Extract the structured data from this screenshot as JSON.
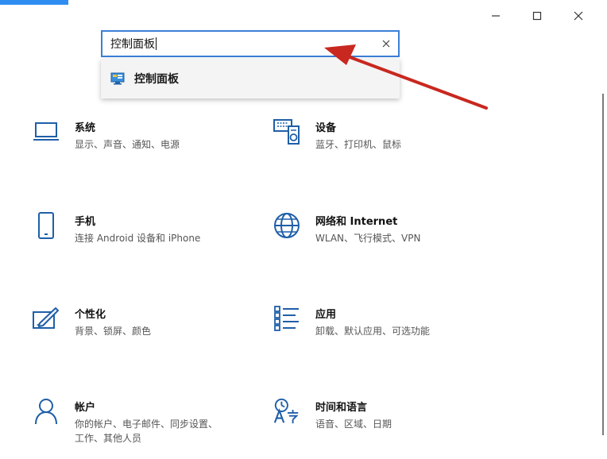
{
  "window": {
    "minimize_symbol": "—",
    "accent_color": "#2f8df1"
  },
  "search": {
    "value": "控制面板"
  },
  "suggestions": [
    {
      "label": "控制面板",
      "icon": "control-panel-icon"
    }
  ],
  "tiles": [
    {
      "title": "系统",
      "subtitle": "显示、声音、通知、电源",
      "icon": "laptop-icon"
    },
    {
      "title": "设备",
      "subtitle": "蓝牙、打印机、鼠标",
      "icon": "devices-icon"
    },
    {
      "title": "手机",
      "subtitle": "连接 Android 设备和 iPhone",
      "icon": "phone-icon"
    },
    {
      "title": "网络和 Internet",
      "subtitle": "WLAN、飞行模式、VPN",
      "icon": "globe-icon"
    },
    {
      "title": "个性化",
      "subtitle": "背景、锁屏、颜色",
      "icon": "personalization-icon"
    },
    {
      "title": "应用",
      "subtitle": "卸载、默认应用、可选功能",
      "icon": "apps-list-icon"
    },
    {
      "title": "帐户",
      "subtitle": "你的帐户、电子邮件、同步设置、工作、其他人员",
      "icon": "person-icon"
    },
    {
      "title": "时间和语言",
      "subtitle": "语音、区域、日期",
      "icon": "time-language-icon"
    }
  ],
  "colors": {
    "icon_blue": "#1f5fa8",
    "arrow_red": "#c8281f",
    "search_border": "#3b7fd8"
  }
}
